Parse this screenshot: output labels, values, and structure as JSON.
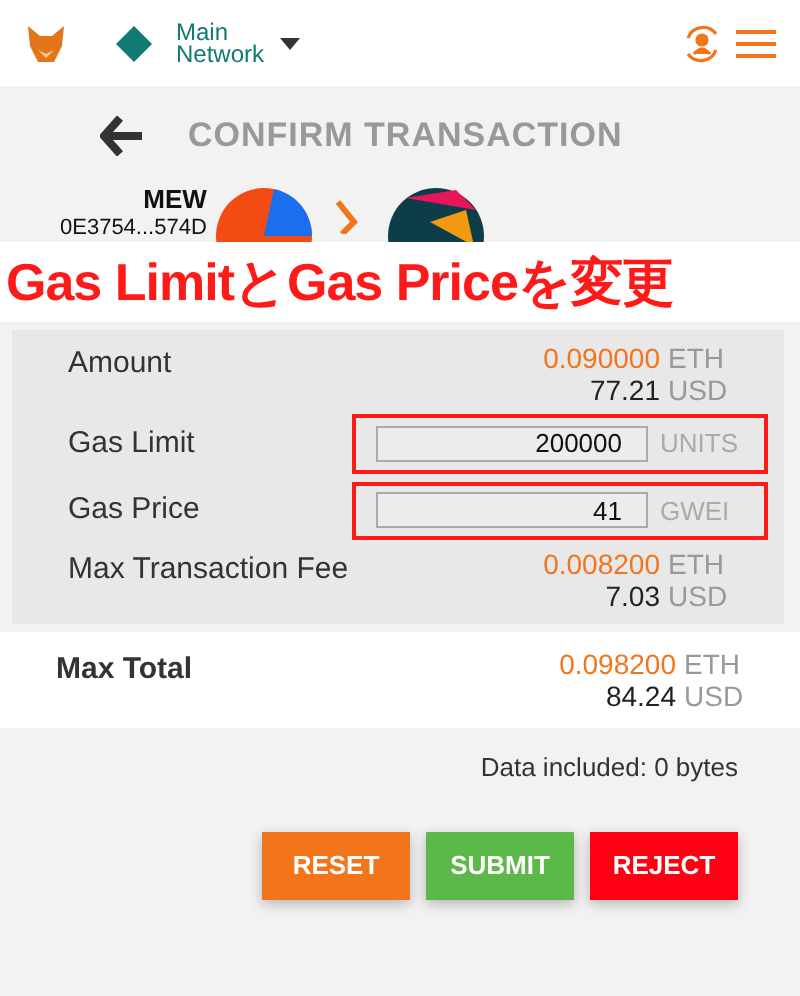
{
  "header": {
    "network": "Main\nNetwork"
  },
  "title": "CONFIRM TRANSACTION",
  "sender": {
    "name": "MEW",
    "address": "0E3754...574D"
  },
  "annotation": "Gas LimitとGas Priceを変更",
  "rows": [
    {
      "kind": "amount",
      "label": "Amount",
      "eth": "0.090000",
      "eth_unit": "ETH",
      "usd": "77.21",
      "usd_unit": "USD"
    },
    {
      "kind": "input",
      "label": "Gas Limit",
      "value": "200000",
      "unit": "UNITS",
      "highlighted": true
    },
    {
      "kind": "input",
      "label": "Gas Price",
      "value": "41",
      "unit": "GWEI",
      "highlighted": true
    },
    {
      "kind": "amount",
      "label": "Max Transaction Fee",
      "eth": "0.008200",
      "eth_unit": "ETH",
      "usd": "7.03",
      "usd_unit": "USD"
    }
  ],
  "total": {
    "label": "Max Total",
    "eth": "0.098200",
    "eth_unit": "ETH",
    "usd": "84.24",
    "usd_unit": "USD"
  },
  "data_note": "Data included: 0 bytes",
  "buttons": [
    {
      "label": "RESET",
      "color": "#f2741b"
    },
    {
      "label": "SUBMIT",
      "color": "#5cb848"
    },
    {
      "label": "REJECT",
      "color": "#ff0012"
    }
  ]
}
